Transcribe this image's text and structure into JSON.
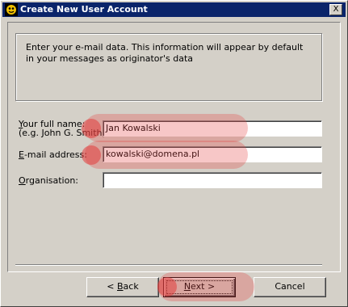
{
  "window": {
    "title": "Create New User Account",
    "close_glyph": "X"
  },
  "info": {
    "text": "Enter your e-mail data. This information will appear by default in your messages as originator's data"
  },
  "form": {
    "full_name": {
      "label_prefix": "",
      "label_accel": "Y",
      "label_rest": "our full name:",
      "hint": "(e.g. John G. Smith)",
      "value": "Jan Kowalski"
    },
    "email": {
      "label_accel": "E",
      "label_rest": "-mail address:",
      "value": "kowalski@domena.pl"
    },
    "organisation": {
      "label_accel": "O",
      "label_rest": "rganisation:",
      "value": ""
    }
  },
  "buttons": {
    "back": {
      "prefix": "<  ",
      "accel": "B",
      "rest": "ack"
    },
    "next": {
      "accel": "N",
      "rest": "ext  >"
    },
    "cancel": {
      "label": "Cancel"
    }
  },
  "colors": {
    "titlebar": "#0a246a",
    "dialog_bg": "#d4d0c8",
    "highlight": "#e64646"
  },
  "icons": {
    "title_icon": "app-logo-icon"
  }
}
